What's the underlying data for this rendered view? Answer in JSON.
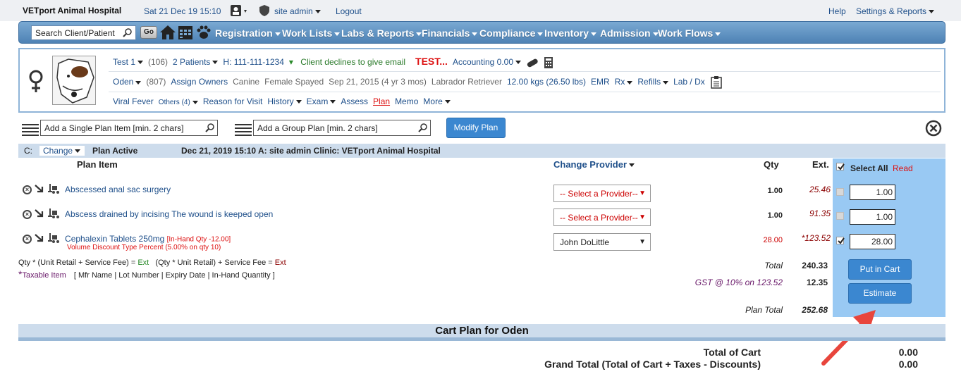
{
  "topbar": {
    "hospital": "VETport Animal Hospital",
    "datetime": "Sat 21 Dec 19 15:10",
    "user": "site admin",
    "logout": "Logout",
    "help": "Help",
    "settings": "Settings & Reports"
  },
  "nav": {
    "search_placeholder": "Search Client/Patient",
    "go": "Go",
    "items": [
      "Registration",
      "Work Lists",
      "Labs & Reports",
      "Financials",
      "Compliance",
      "Inventory",
      "Admission",
      "Work Flows"
    ]
  },
  "patient": {
    "client_name": "Test 1",
    "client_id": "(106)",
    "patients_link": "2 Patients",
    "phone": "H: 111-111-1234",
    "email_note": "Client declines to give email",
    "flag": "TEST...",
    "accounting": "Accounting 0.00",
    "pet_name": "Oden",
    "pet_id": "(807)",
    "assign_owners": "Assign Owners",
    "species": "Canine",
    "sex": "Female Spayed",
    "dob": "Sep 21, 2015 (4 yr 3 mos)",
    "breed": "Labrador Retriever",
    "weight": "12.00 kgs (26.50 lbs)",
    "emr": "EMR",
    "rx": "Rx",
    "refills": "Refills",
    "lab": "Lab / Dx",
    "visit_reason": "Viral Fever",
    "others": "Others (4)",
    "tabs": [
      "Reason for Visit",
      "History",
      "Exam",
      "Assess",
      "Plan",
      "Memo",
      "More"
    ]
  },
  "plan_inputs": {
    "single_placeholder": "Add a Single Plan Item [min. 2 chars]",
    "group_placeholder": "Add a Group Plan [min. 2 chars]",
    "modify": "Modify Plan"
  },
  "plan_header": {
    "c_label": "C:",
    "change": "Change",
    "status": "Plan Active",
    "meta": "Dec 21, 2019 15:10  A: site admin  Clinic: VETport Animal Hospital"
  },
  "columns": {
    "item": "Plan Item",
    "provider": "Change Provider",
    "qty": "Qty",
    "ext": "Ext.",
    "select_all": "Select All",
    "read": "Read"
  },
  "items": [
    {
      "name": "Abscessed anal sac surgery",
      "note": "",
      "note2": "",
      "provider": "-- Select a Provider--",
      "qty": "1.00",
      "ext": "25.46",
      "input_qty": "1.00"
    },
    {
      "name": "Abscess drained by incising The wound is keeped open",
      "note": "",
      "note2": "",
      "provider": "-- Select a Provider--",
      "qty": "1.00",
      "ext": "91.35",
      "input_qty": "1.00"
    },
    {
      "name": "Cephalexin Tablets 250mg",
      "note": "[In-Hand Qty -12.00]",
      "note2": "Volume Discount Type Percent (5.00% on qty 10)",
      "provider": "John DoLittle",
      "qty": "28.00",
      "ext": "*123.52",
      "input_qty": "28.00"
    }
  ],
  "legend": {
    "line1_a": "Qty * (Unit Retail + Service Fee) = ",
    "line1_b": "Ext",
    "line1_c": "   (Qty * Unit Retail) + Service Fee = ",
    "line1_d": "Ext",
    "taxable": "Taxable Item",
    "fields": "[ Mfr Name | Lot Number | Expiry Date | In-Hand Quantity ]"
  },
  "totals": {
    "total_label": "Total",
    "total": "240.33",
    "gst_label": "GST @ 10% on 123.52",
    "gst": "12.35",
    "plan_total_label": "Plan Total",
    "plan_total": "252.68"
  },
  "buttons": {
    "put_in_cart": "Put in Cart",
    "estimate": "Estimate"
  },
  "cart": {
    "title": "Cart Plan for Oden",
    "total_of_cart_label": "Total of Cart",
    "total_of_cart": "0.00",
    "grand_total_label": "Grand Total (Total of Cart + Taxes - Discounts)",
    "grand_total": "0.00"
  }
}
